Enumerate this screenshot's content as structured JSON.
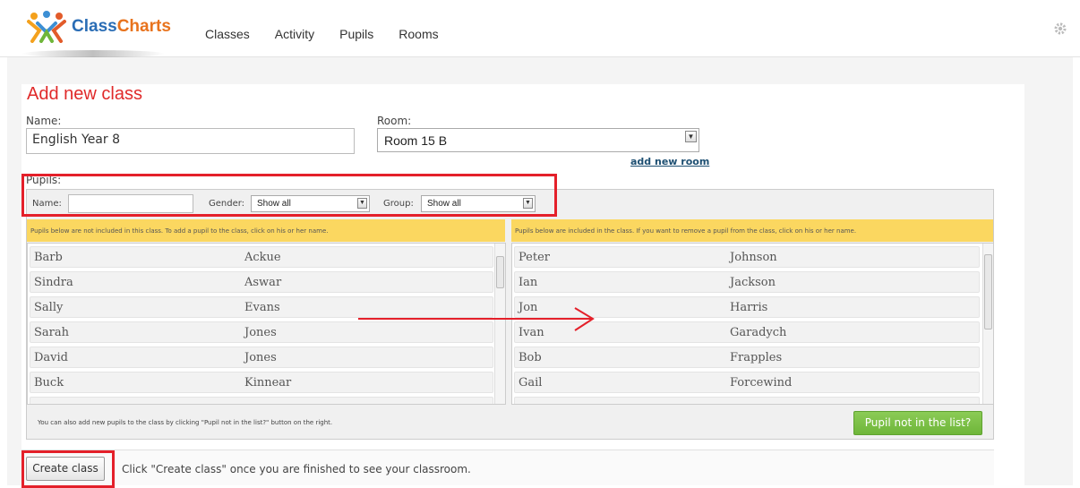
{
  "app": {
    "logo_part1": "Class",
    "logo_part2": "Charts",
    "nav": [
      "Classes",
      "Activity",
      "Pupils",
      "Rooms"
    ]
  },
  "page": {
    "title": "Add new class"
  },
  "form": {
    "name_label": "Name:",
    "name_value": "English Year 8",
    "room_label": "Room:",
    "room_value": "Room 15 B",
    "add_room_link": "add new room",
    "pupils_label": "Pupils:",
    "filter": {
      "name_label": "Name:",
      "name_value": "",
      "gender_label": "Gender:",
      "gender_value": "Show all",
      "group_label": "Group:",
      "group_value": "Show all"
    }
  },
  "left_panel": {
    "notice": "Pupils below are not included in this class. To add a pupil to the class, click on his or her name.",
    "pupils": [
      {
        "first": "Barb",
        "last": "Ackue"
      },
      {
        "first": "Sindra",
        "last": "Aswar"
      },
      {
        "first": "Sally",
        "last": "Evans"
      },
      {
        "first": "Sarah",
        "last": "Jones"
      },
      {
        "first": "David",
        "last": "Jones"
      },
      {
        "first": "Buck",
        "last": "Kinnear"
      }
    ]
  },
  "right_panel": {
    "notice": "Pupils below are included in the class. If you want to remove a pupil from the class, click on his or her name.",
    "pupils": [
      {
        "first": "Peter",
        "last": "Johnson"
      },
      {
        "first": "Ian",
        "last": "Jackson"
      },
      {
        "first": "Jon",
        "last": "Harris"
      },
      {
        "first": "Ivan",
        "last": "Garadych"
      },
      {
        "first": "Bob",
        "last": "Frapples"
      },
      {
        "first": "Gail",
        "last": "Forcewind"
      }
    ]
  },
  "footer": {
    "note": "You can also add new pupils to the class by clicking \"Pupil not in the list?\" button on the right.",
    "pupil_button": "Pupil not in the list?",
    "create_button": "Create class",
    "create_note": "Click \"Create class\" once you are finished to see your classroom."
  },
  "colors": {
    "title": "#e02a2a",
    "notice_bg": "#fbd760",
    "green_button": "#7bbf45",
    "highlight": "#e4202a"
  }
}
